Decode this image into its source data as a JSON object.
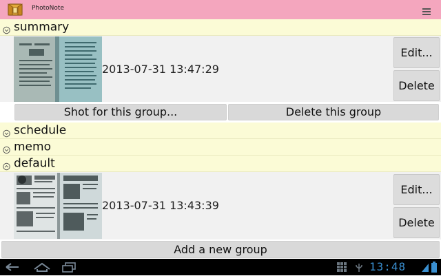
{
  "app": {
    "title": "PhotoNote"
  },
  "groups": {
    "summary": {
      "label": "summary",
      "expanded": true,
      "item": {
        "timestamp": "2013-07-31 13:47:29",
        "edit_label": "Edit...",
        "delete_label": "Delete"
      },
      "shot_label": "Shot for this group...",
      "delete_group_label": "Delete this group"
    },
    "schedule": {
      "label": "schedule",
      "expanded": false
    },
    "memo": {
      "label": "memo",
      "expanded": false
    },
    "default": {
      "label": "default",
      "expanded": true,
      "item": {
        "timestamp": "2013-07-31 13:43:39",
        "edit_label": "Edit...",
        "delete_label": "Delete"
      }
    }
  },
  "add_group_label": "Add a new group",
  "system": {
    "clock": "13:48"
  },
  "colors": {
    "action_bar": "#f4a6be",
    "group_header": "#fbfbd6",
    "panel": "#f1f1f1",
    "button": "#dcdcdc",
    "system_bar": "#000000",
    "clock": "#3a8fd0"
  },
  "icons": {
    "app": "photonote-app-icon",
    "menu": "overflow-menu-icon",
    "expanded": "expanded-group-icon",
    "collapsed": "collapsed-group-icon"
  }
}
